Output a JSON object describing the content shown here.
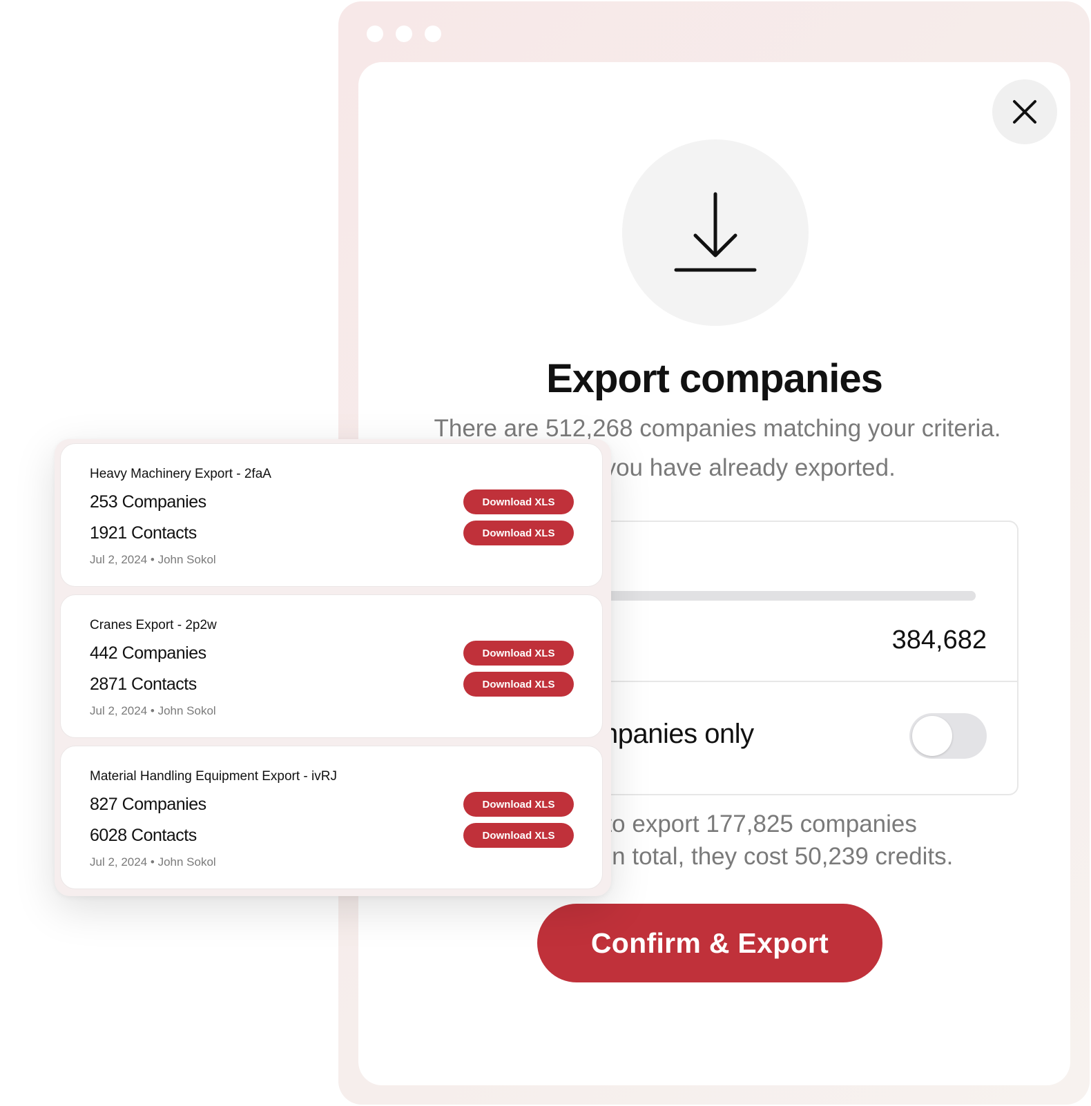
{
  "modal": {
    "title": "Export companies",
    "description_line1": "There are 512,268 companies matching your criteria.",
    "description_line2": "anies you have already exported.",
    "count_value": "384,682",
    "progress_fraction": 1.0,
    "toggle_label": "npanies only",
    "toggle_on": false,
    "summary_line1": "t to export 177,825 companies",
    "summary_line2": ". In total, they cost 50,239 credits.",
    "confirm_label": "Confirm & Export"
  },
  "exports": [
    {
      "title": "Heavy Machinery Export - 2faA",
      "companies": "253 Companies",
      "contacts": "1921 Contacts",
      "meta": "Jul 2, 2024 • John Sokol",
      "download_companies_label": "Download XLS",
      "download_contacts_label": "Download XLS"
    },
    {
      "title": "Cranes Export - 2p2w",
      "companies": "442 Companies",
      "contacts": "2871 Contacts",
      "meta": "Jul 2, 2024 • John Sokol",
      "download_companies_label": "Download XLS",
      "download_contacts_label": "Download XLS"
    },
    {
      "title": "Material Handling Equipment Export - ivRJ",
      "companies": "827 Companies",
      "contacts": "6028 Contacts",
      "meta": "Jul 2, 2024 • John Sokol",
      "download_companies_label": "Download XLS",
      "download_contacts_label": "Download XLS"
    }
  ],
  "icons": {
    "close": "close-icon",
    "download": "download-icon"
  },
  "colors": {
    "accent": "#c0313a",
    "window_frame": "#f6ebea",
    "muted_text": "#7a7a7a"
  }
}
